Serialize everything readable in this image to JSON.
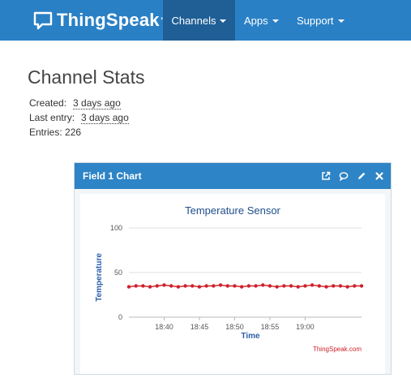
{
  "nav": {
    "brand": "ThingSpeak",
    "brand_tm": "™",
    "items": [
      {
        "label": "Channels",
        "active": true
      },
      {
        "label": "Apps",
        "active": false
      },
      {
        "label": "Support",
        "active": false
      }
    ]
  },
  "stats": {
    "title": "Channel Stats",
    "created_label": "Created:",
    "created_value": "3 days ago",
    "last_entry_label": "Last entry:",
    "last_entry_value": "3 days ago",
    "entries": "Entries: 226"
  },
  "panel": {
    "title": "Field 1 Chart",
    "icons": [
      "external-link-icon",
      "comment-icon",
      "pencil-icon",
      "close-icon"
    ]
  },
  "colors": {
    "navbar": "#2a80c5",
    "nav_active": "#1f5f96",
    "panel_header": "#2d84c6",
    "series": "#d0202a",
    "chart_title": "#1f4e8c"
  },
  "chart_data": {
    "type": "line",
    "title": "Temperature Sensor",
    "xlabel": "Time",
    "ylabel": "Temperature",
    "ylim": [
      0,
      100
    ],
    "yticks": [
      0,
      50,
      100
    ],
    "xlim": [
      "18:35",
      "19:08"
    ],
    "xticks": [
      "18:40",
      "18:45",
      "18:50",
      "18:55",
      "19:00"
    ],
    "credit": "ThingSpeak.com",
    "grid": true,
    "series": [
      {
        "x": [
          "18:35",
          "18:36",
          "18:37",
          "18:38",
          "18:39",
          "18:40",
          "18:41",
          "18:42",
          "18:43",
          "18:44",
          "18:45",
          "18:46",
          "18:47",
          "18:48",
          "18:49",
          "18:50",
          "18:51",
          "18:52",
          "18:53",
          "18:54",
          "18:55",
          "18:56",
          "18:57",
          "18:58",
          "18:59",
          "19:00",
          "19:01",
          "19:02",
          "19:03",
          "19:04",
          "19:05",
          "19:06",
          "19:07",
          "19:08"
        ],
        "y": [
          34,
          35,
          35,
          34,
          35,
          36,
          35,
          34,
          35,
          35,
          34,
          35,
          35,
          36,
          35,
          35,
          34,
          35,
          35,
          36,
          35,
          34,
          35,
          35,
          34,
          35,
          36,
          35,
          34,
          35,
          35,
          34,
          35,
          35
        ]
      }
    ]
  }
}
